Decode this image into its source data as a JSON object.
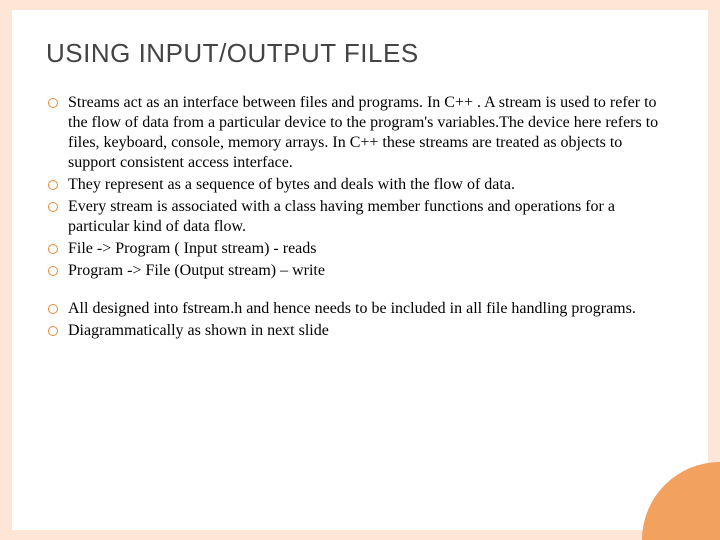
{
  "title": "USING INPUT/OUTPUT FILES",
  "group1": [
    "Streams act as an interface between files and programs. In C++ . A stream is used to refer to the flow of data from a particular device to the program's variables.The device here refers to files, keyboard, console, memory arrays. In C++  these streams are treated as objects to support consistent access interface.",
    "They represent as a sequence of bytes and deals with the flow of data.",
    "Every stream is associated with a class having member functions and operations for a particular kind of data flow.",
    "File -> Program ( Input stream)  - reads",
    "Program -> File (Output stream) – write"
  ],
  "group2": [
    "All designed into fstream.h and hence needs to be included in all file handling programs.",
    "Diagrammatically as shown in next slide"
  ]
}
